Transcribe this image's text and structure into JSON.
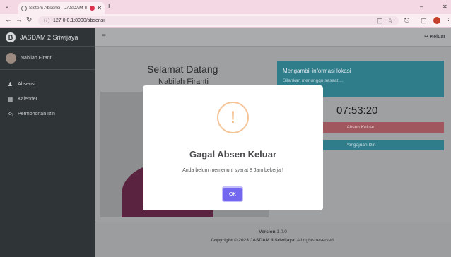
{
  "browser": {
    "tab_title": "Sistem Absensi - JASDAM II",
    "new_tab": "+",
    "url": "127.0.0.1:8000/absensi",
    "controls": {
      "minimize": "–",
      "more": "⋮"
    }
  },
  "sidebar": {
    "brand": "JASDAM 2 Sriwijaya",
    "brand_logo": "B",
    "user_name": "Nabilah Firanti",
    "items": [
      {
        "label": "Absensi",
        "icon": "users-icon"
      },
      {
        "label": "Kalender",
        "icon": "calendar-icon"
      },
      {
        "label": "Permohonan Izin",
        "icon": "printer-icon"
      }
    ]
  },
  "header": {
    "menu_toggle": "≡",
    "logout_label": "Keluar"
  },
  "main": {
    "welcome": "Selamat Datang",
    "user_name": "Nabilah Firanti",
    "location_card": {
      "title": "Mengambil informasi lokasi",
      "subtitle": "Silahkan menunggu sesaat ..."
    },
    "clock": "07:53:20",
    "checkout_button": "Absen Keluar",
    "leave_button": "Pengajuan Izin"
  },
  "footer": {
    "version_label": "Version",
    "version": "1.0.0",
    "copyright_prefix": "Copyright © 2023",
    "company": "JASDAM II Sriwijaya.",
    "rights": "All rights reserved."
  },
  "modal": {
    "icon": "!",
    "title": "Gagal Absen Keluar",
    "message": "Anda belum memenuhi syarat 8 Jam bekerja !",
    "ok_label": "OK"
  },
  "colors": {
    "sidebar_bg": "#343a40",
    "info": "#17a2b8",
    "danger": "#dc3545",
    "primary_modal": "#7367f0",
    "warning_icon": "#f8bb86"
  }
}
